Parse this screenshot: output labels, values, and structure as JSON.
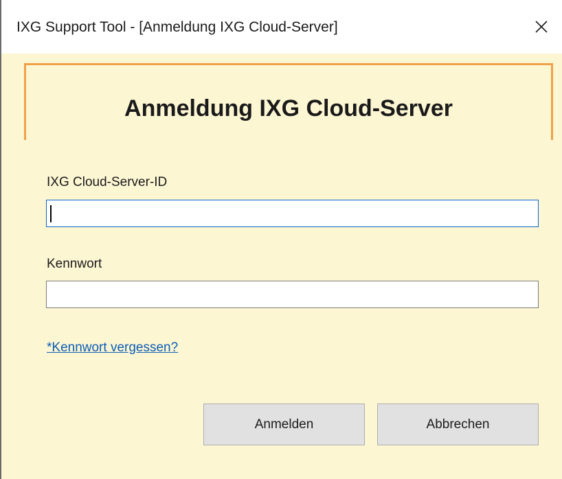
{
  "window": {
    "title": "IXG Support Tool - [Anmeldung IXG Cloud-Server]",
    "close_glyph": "✕",
    "close_icon": "close-icon"
  },
  "header": {
    "title": "Anmeldung IXG Cloud-Server",
    "frame_color": "#f0a147"
  },
  "form": {
    "server_id_label": "IXG Cloud-Server-ID",
    "server_id_value": "",
    "password_label": "Kennwort",
    "password_value": "",
    "forgot_link": "*Kennwort vergessen?"
  },
  "buttons": {
    "login": "Anmelden",
    "cancel": "Abbrechen"
  },
  "colors": {
    "background": "#fdf6d3",
    "accent": "#f0a147",
    "link": "#0b5db5",
    "focus": "#0a63c9"
  }
}
